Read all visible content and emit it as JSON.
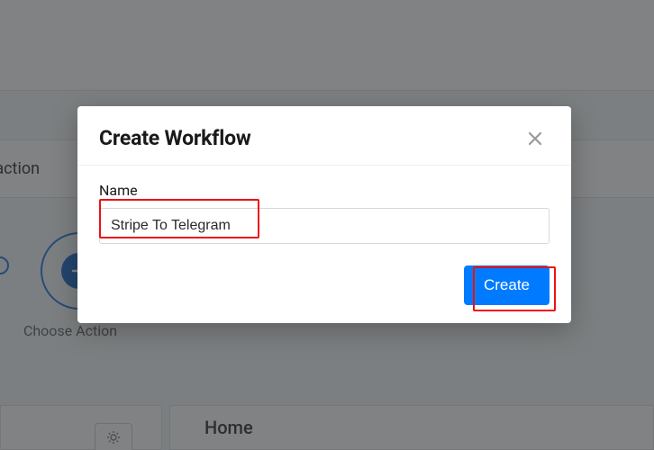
{
  "background": {
    "header_text": "and action",
    "step_label": "Choose Action",
    "home_label": "Home"
  },
  "modal": {
    "title": "Create Workflow",
    "name_label": "Name",
    "name_value": "Stripe To Telegram",
    "create_label": "Create"
  }
}
